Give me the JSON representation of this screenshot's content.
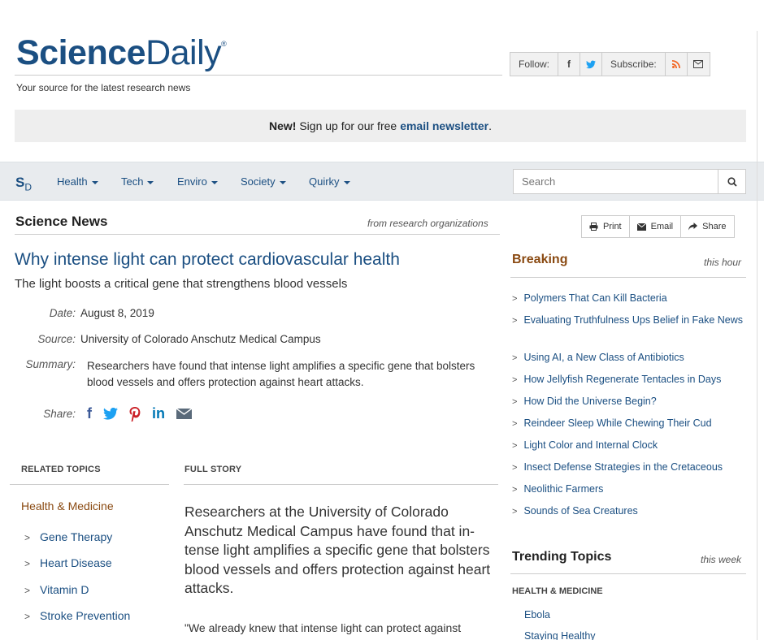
{
  "header": {
    "logo_part1": "Science",
    "logo_part2": "Daily",
    "logo_reg": "®",
    "tagline": "Your source for the latest research news"
  },
  "follow_bar": {
    "follow_label": "Follow:",
    "facebook_icon": "f",
    "twitter_icon": "twitter-bird",
    "subscribe_label": "Subscribe:",
    "rss_icon": "rss",
    "email_icon": "envelope"
  },
  "newsletter": {
    "new_label": "New!",
    "text": "Sign up for our free",
    "link": "email newsletter",
    "end": "."
  },
  "nav": {
    "mark_s": "S",
    "mark_d": "D",
    "items": [
      "Health",
      "Tech",
      "Enviro",
      "Society",
      "Quirky"
    ],
    "search_placeholder": "Search"
  },
  "section": {
    "title": "Science News",
    "subtitle": "from research organizations"
  },
  "tools": {
    "print": "Print",
    "email": "Email",
    "share": "Share"
  },
  "article": {
    "headline": "Why intense light can protect cardiovascular health",
    "subhead": "The light boosts a critical gene that strengthens blood vessels",
    "date_label": "Date:",
    "date": "August 8, 2019",
    "source_label": "Source:",
    "source": "University of Colorado Anschutz Medical Campus",
    "summary_label": "Summary:",
    "summary": "Researchers have found that intense light amplifies a specific gene that bol­sters blood vessels and offers protection against heart attacks.",
    "share_label": "Share:"
  },
  "related": {
    "heading": "RELATED TOPICS",
    "category": "Health & Medicine",
    "items": [
      "Gene Therapy",
      "Heart Disease",
      "Vitamin D",
      "Stroke Prevention"
    ]
  },
  "story": {
    "heading": "FULL STORY",
    "lead": "Researchers at the University of Colorado Anschutz Medical Campus have found that in­tense light amplifies a specific gene that bol­sters blood vessels and offers protection against heart attacks.",
    "quote": "\"We already knew that intense light can protect against"
  },
  "breaking": {
    "title": "Breaking",
    "subtitle": "this hour",
    "items": [
      "Polymers That Can Kill Bacteria",
      "Evaluating Truthfulness Ups Belief in Fake News",
      "Using AI, a New Class of Antibiotics",
      "How Jellyfish Regenerate Tentacles in Days",
      "How Did the Universe Begin?",
      "Reindeer Sleep While Chewing Their Cud",
      "Light Color and Internal Clock",
      "Insect Defense Strategies in the Cretaceous",
      "Neolithic Farmers",
      "Sounds of Sea Creatures"
    ]
  },
  "trending": {
    "title": "Trending Topics",
    "subtitle": "this week",
    "category": "HEALTH & MEDICINE",
    "items": [
      "Ebola",
      "Staying Healthy"
    ]
  },
  "colors": {
    "brand_blue": "#1b4f82",
    "accent_brown": "#8a4a12",
    "facebook": "#3b5998",
    "twitter": "#1da1f2",
    "pinterest": "#cb2027",
    "linkedin": "#0077b5",
    "rss": "#f26522"
  }
}
